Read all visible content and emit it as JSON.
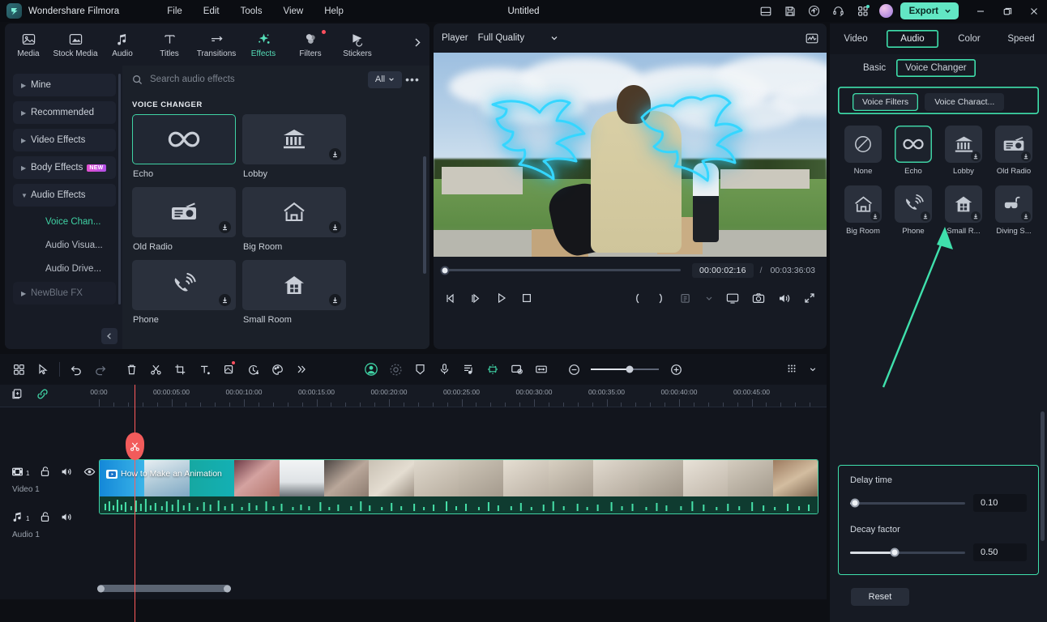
{
  "titlebar": {
    "brand": "Wondershare Filmora",
    "menus": [
      "File",
      "Edit",
      "Tools",
      "View",
      "Help"
    ],
    "window_title": "Untitled",
    "export_label": "Export",
    "icons": [
      "panel-layout-icon",
      "save-icon",
      "cloud-upload-icon",
      "headset-support-icon",
      "apps-grid-icon"
    ],
    "window_controls": [
      "minimize-button",
      "maximize-button",
      "close-button"
    ],
    "accent": "#62e6c4"
  },
  "top_tabs": [
    {
      "label": "Media",
      "icon": "media-icon",
      "active": false,
      "new": false
    },
    {
      "label": "Stock Media",
      "icon": "stock-media-icon",
      "active": false,
      "new": false
    },
    {
      "label": "Audio",
      "icon": "audio-note-icon",
      "active": false,
      "new": false
    },
    {
      "label": "Titles",
      "icon": "titles-icon",
      "active": false,
      "new": false
    },
    {
      "label": "Transitions",
      "icon": "transitions-icon",
      "active": false,
      "new": false
    },
    {
      "label": "Effects",
      "icon": "effects-sparkle-icon",
      "active": true,
      "new": false
    },
    {
      "label": "Filters",
      "icon": "filters-icon",
      "active": false,
      "new": true
    },
    {
      "label": "Stickers",
      "icon": "stickers-icon",
      "active": false,
      "new": false
    }
  ],
  "left_panel": {
    "categories": [
      {
        "label": "Mine",
        "expanded": false,
        "badge": null,
        "dim": false
      },
      {
        "label": "Recommended",
        "expanded": false,
        "badge": null,
        "dim": false
      },
      {
        "label": "Video Effects",
        "expanded": false,
        "badge": null,
        "dim": false
      },
      {
        "label": "Body Effects",
        "expanded": false,
        "badge": "NEW",
        "dim": false
      },
      {
        "label": "Audio Effects",
        "expanded": true,
        "badge": null,
        "dim": false
      }
    ],
    "subcategories": [
      {
        "label": "Voice Chan...",
        "active": true
      },
      {
        "label": "Audio Visua...",
        "active": false
      },
      {
        "label": "Audio Drive...",
        "active": false
      }
    ],
    "tail_category": {
      "label": "NewBlue FX",
      "dim": true
    },
    "search": {
      "placeholder": "Search audio effects",
      "value": ""
    },
    "filter_label": "All",
    "group_header": "VOICE CHANGER",
    "effects": [
      {
        "name": "Echo",
        "icon": "infinity-icon",
        "selected": true,
        "downloadable": false
      },
      {
        "name": "Lobby",
        "icon": "bank-building-icon",
        "selected": false,
        "downloadable": true
      },
      {
        "name": "Old Radio",
        "icon": "radio-icon",
        "selected": false,
        "downloadable": true
      },
      {
        "name": "Big Room",
        "icon": "house-outline-icon",
        "selected": false,
        "downloadable": true
      },
      {
        "name": "Phone",
        "icon": "phone-ringing-icon",
        "selected": false,
        "downloadable": true
      },
      {
        "name": "Small Room",
        "icon": "house-windows-icon",
        "selected": false,
        "downloadable": true
      }
    ]
  },
  "player": {
    "title": "Player",
    "quality": "Full Quality",
    "scope_icon": "waveform-scope-icon",
    "current_time": "00:00:02:16",
    "separator": "/",
    "total_time": "00:03:36:03",
    "progress_percent": 1,
    "controls_left": [
      "prev-frame-button",
      "next-frame-button",
      "play-button",
      "stop-button"
    ],
    "controls_right": [
      "mark-in-button",
      "mark-out-button",
      "render-preview-button",
      "render-dropdown-button",
      "fullscreen-monitor-button",
      "snapshot-button",
      "volume-button",
      "expand-button"
    ]
  },
  "right_panel": {
    "tabs": [
      {
        "label": "Video",
        "highlighted": false
      },
      {
        "label": "Audio",
        "highlighted": true
      },
      {
        "label": "Color",
        "highlighted": false
      },
      {
        "label": "Speed",
        "highlighted": false
      }
    ],
    "subtabs": [
      {
        "label": "Basic",
        "highlighted": false
      },
      {
        "label": "Voice Changer",
        "highlighted": true
      }
    ],
    "pills": [
      {
        "label": "Voice Filters",
        "selected": true
      },
      {
        "label": "Voice Charact...",
        "selected": false
      }
    ],
    "voice_filters": [
      {
        "name": "None",
        "icon": "none-circle-slash-icon",
        "selected": false,
        "downloadable": false
      },
      {
        "name": "Echo",
        "icon": "infinity-icon",
        "selected": true,
        "downloadable": false
      },
      {
        "name": "Lobby",
        "icon": "bank-building-icon",
        "selected": false,
        "downloadable": true
      },
      {
        "name": "Old Radio",
        "icon": "radio-icon",
        "selected": false,
        "downloadable": true
      },
      {
        "name": "Big Room",
        "icon": "house-outline-icon",
        "selected": false,
        "downloadable": true
      },
      {
        "name": "Phone",
        "icon": "phone-ringing-icon",
        "selected": false,
        "downloadable": true
      },
      {
        "name": "Small R...",
        "icon": "house-windows-icon",
        "selected": false,
        "downloadable": true
      },
      {
        "name": "Diving S...",
        "icon": "diving-mask-icon",
        "selected": false,
        "downloadable": true
      }
    ],
    "parameters": [
      {
        "label": "Delay time",
        "value": "0.10",
        "fill_percent": 4
      },
      {
        "label": "Decay factor",
        "value": "0.50",
        "fill_percent": 39
      }
    ],
    "reset_label": "Reset",
    "highlight_color": "#3fe0ac"
  },
  "timeline": {
    "toolbar_left": [
      "project-media-icon",
      "selection-tool-icon"
    ],
    "toolbar_edit": [
      "undo-icon",
      "redo-icon",
      "delete-icon",
      "split-scissors-icon",
      "crop-icon",
      "text-icon",
      "mask-icon",
      "speed-icon",
      "color-match-icon",
      "more-chevron-icon"
    ],
    "toolbar_mid": [
      "ai-portrait-icon",
      "ai-smart-cutout-icon",
      "keyframe-icon",
      "voiceover-mic-icon",
      "audio-ducking-icon",
      "ai-audio-stretch-icon",
      "screen-record-icon",
      "marker-icon"
    ],
    "zoom": {
      "out_icon": "zoom-out-icon",
      "in_icon": "zoom-in-icon",
      "level_percent": 55
    },
    "toolbar_right": [
      "zoom-fit-grid-icon",
      "toolbar-overflow-icon"
    ],
    "ruler_icons": [
      "duplicate-track-icon",
      "link-icon"
    ],
    "ruler_labels": [
      "00:00",
      "00:00:05:00",
      "00:00:10:00",
      "00:00:15:00",
      "00:00:20:00",
      "00:00:25:00",
      "00:00:30:00",
      "00:00:35:00",
      "00:00:40:00",
      "00:00:45:00",
      "00:00"
    ],
    "tracks": [
      {
        "name": "Video 1",
        "index": "1",
        "type": "video",
        "icons": [
          "video-track-icon",
          "lock-icon",
          "mute-icon",
          "eye-icon"
        ]
      },
      {
        "name": "Audio 1",
        "index": "1",
        "type": "audio",
        "icons": [
          "audio-track-icon",
          "lock-icon",
          "mute-icon"
        ]
      }
    ],
    "clip": {
      "title": "How to Make an Animation",
      "badge": "youtube-play-icon"
    },
    "playhead_time": "00:00:02:16"
  }
}
